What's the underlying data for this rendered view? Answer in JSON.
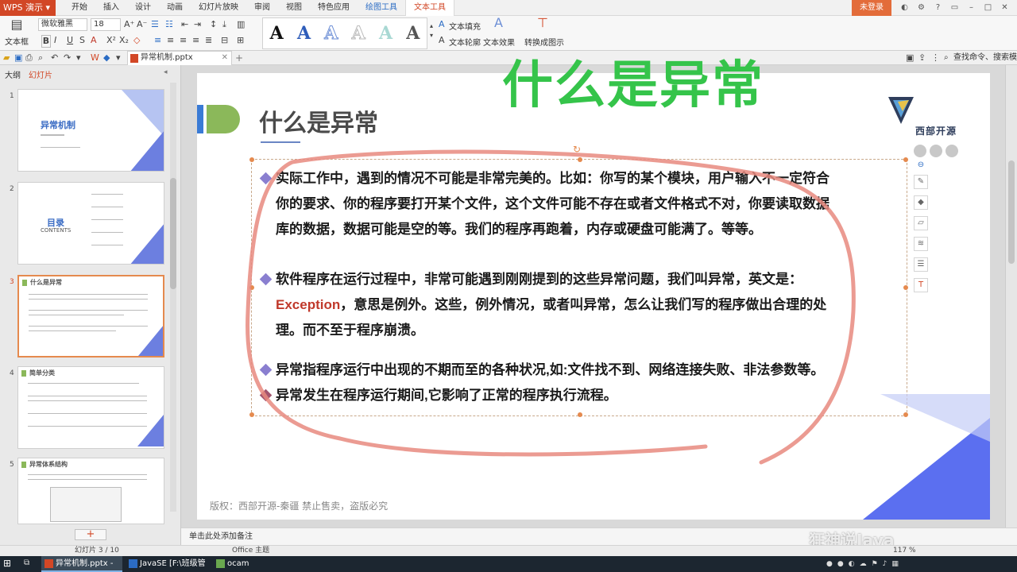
{
  "menubar": {
    "app": "WPS 演示",
    "tabs": [
      "开始",
      "插入",
      "设计",
      "动画",
      "幻灯片放映",
      "审阅",
      "视图",
      "特色应用",
      "绘图工具",
      "文本工具"
    ],
    "active_tab": "文本工具",
    "login": "未登录"
  },
  "ribbon": {
    "textbox_label": "文本框",
    "font_name": "微软雅黑",
    "font_size": "18",
    "text_fill": "文本填充",
    "text_outline": "文本轮廓",
    "text_effect": "文本效果",
    "convert": "转换成图示"
  },
  "qbar": {
    "doc_tab": "异常机制.pptx",
    "find": "查找命令、搜索模板"
  },
  "leftpane": {
    "tab_outline": "大纲",
    "tab_slides": "幻灯片",
    "thumbs": [
      {
        "num": "1",
        "title": "异常机制"
      },
      {
        "num": "2",
        "title": "目录",
        "subtitle": "CONTENTS"
      },
      {
        "num": "3",
        "title": "什么是异常"
      },
      {
        "num": "4",
        "title": "简单分类"
      },
      {
        "num": "5",
        "title": "异常体系结构"
      }
    ]
  },
  "slide": {
    "title": "什么是异常",
    "logo_text": "西部开源",
    "bullets": {
      "b1": [
        "实际工作中，遇到的情况不可能是非常完美的。比如：你写的某个模块，用户输入不一定符合",
        "你的要求、你的程序要打开某个文件，这个文件可能不存在或者文件格式不对，你要读取数据",
        "库的数据，数据可能是空的等。我们的程序再跑着，内存或硬盘可能满了。等等。"
      ],
      "b2_line1": "软件程序在运行过程中，非常可能遇到刚刚提到的这些异常问题，我们叫异常，英文是：",
      "b2_highlight": "Exception",
      "b2_line2_rest": "，意思是例外。这些，例外情况，或者叫异常，怎么让我们写的程序做出合理的处",
      "b2_line3": "理。而不至于程序崩溃。",
      "b3": "异常指程序运行中出现的不期而至的各种状况,如:文件找不到、网络连接失败、非法参数等。",
      "b4": "异常发生在程序运行期间,它影响了正常的程序执行流程。"
    },
    "copyright": "版权：西部开源-秦疆    禁止售卖，盗版必究"
  },
  "overlay": {
    "title": "什么是异常",
    "watermark": "狂神说Java"
  },
  "notes": "单击此处添加备注",
  "status": {
    "slide_counter": "幻灯片 3 / 10",
    "theme": "Office 主题",
    "zoom": "117 %"
  },
  "taskbar": {
    "items": [
      "异常机制.pptx - WP...",
      "JavaSE [F:\\班级管理\\...",
      "ocam"
    ]
  },
  "colors": {
    "accent": "#d24726",
    "overlay_green": "#35c44a",
    "bullet_purple": "#8a7fd0",
    "exception_red": "#c0392b"
  }
}
